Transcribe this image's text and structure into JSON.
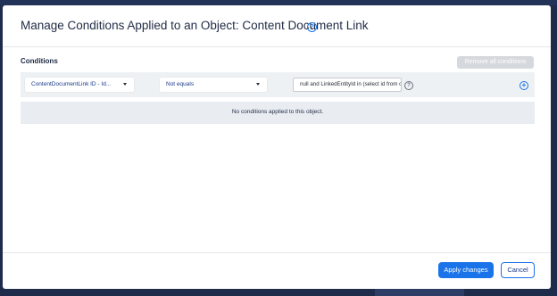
{
  "modal": {
    "title": "Manage Conditions Applied to an Object: Content Document Link",
    "help_icon": "?"
  },
  "conditions": {
    "label": "Conditions",
    "remove_all_label": "Remove all conditions",
    "row": {
      "field_value": "ContentDocumentLink ID - Id...",
      "operator_value": "Not equals",
      "input_value": "null and LinkedEntityId in (select id from op",
      "help_icon": "?",
      "add_icon": "+"
    },
    "empty_message": "No conditions applied to this object."
  },
  "footer": {
    "apply_label": "Apply changes",
    "cancel_label": "Cancel"
  },
  "colors": {
    "primary": "#1a73e8",
    "backdrop": "#1f2b4a"
  }
}
